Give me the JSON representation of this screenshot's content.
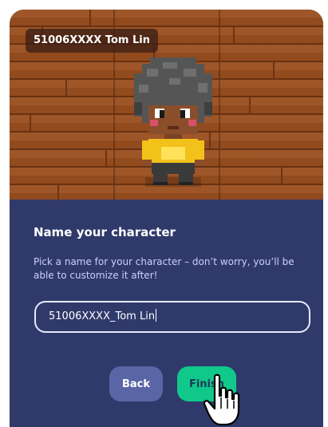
{
  "player_badge": "51006XXXX Tom Lin",
  "panel": {
    "title": "Name your character",
    "description": "Pick a name for your character – don’t worry, you’ll be able to customize it after!"
  },
  "name_input": {
    "value": "51006XXXX_Tom Lin"
  },
  "buttons": {
    "back": "Back",
    "finish": "Finish"
  },
  "colors": {
    "panel_bg": "#2f3a6b",
    "floor": "#9a4f1f",
    "back_button": "#5a65a6",
    "finish_button": "#10c88a"
  },
  "icons": {
    "cursor": "hand-pointer-icon"
  }
}
